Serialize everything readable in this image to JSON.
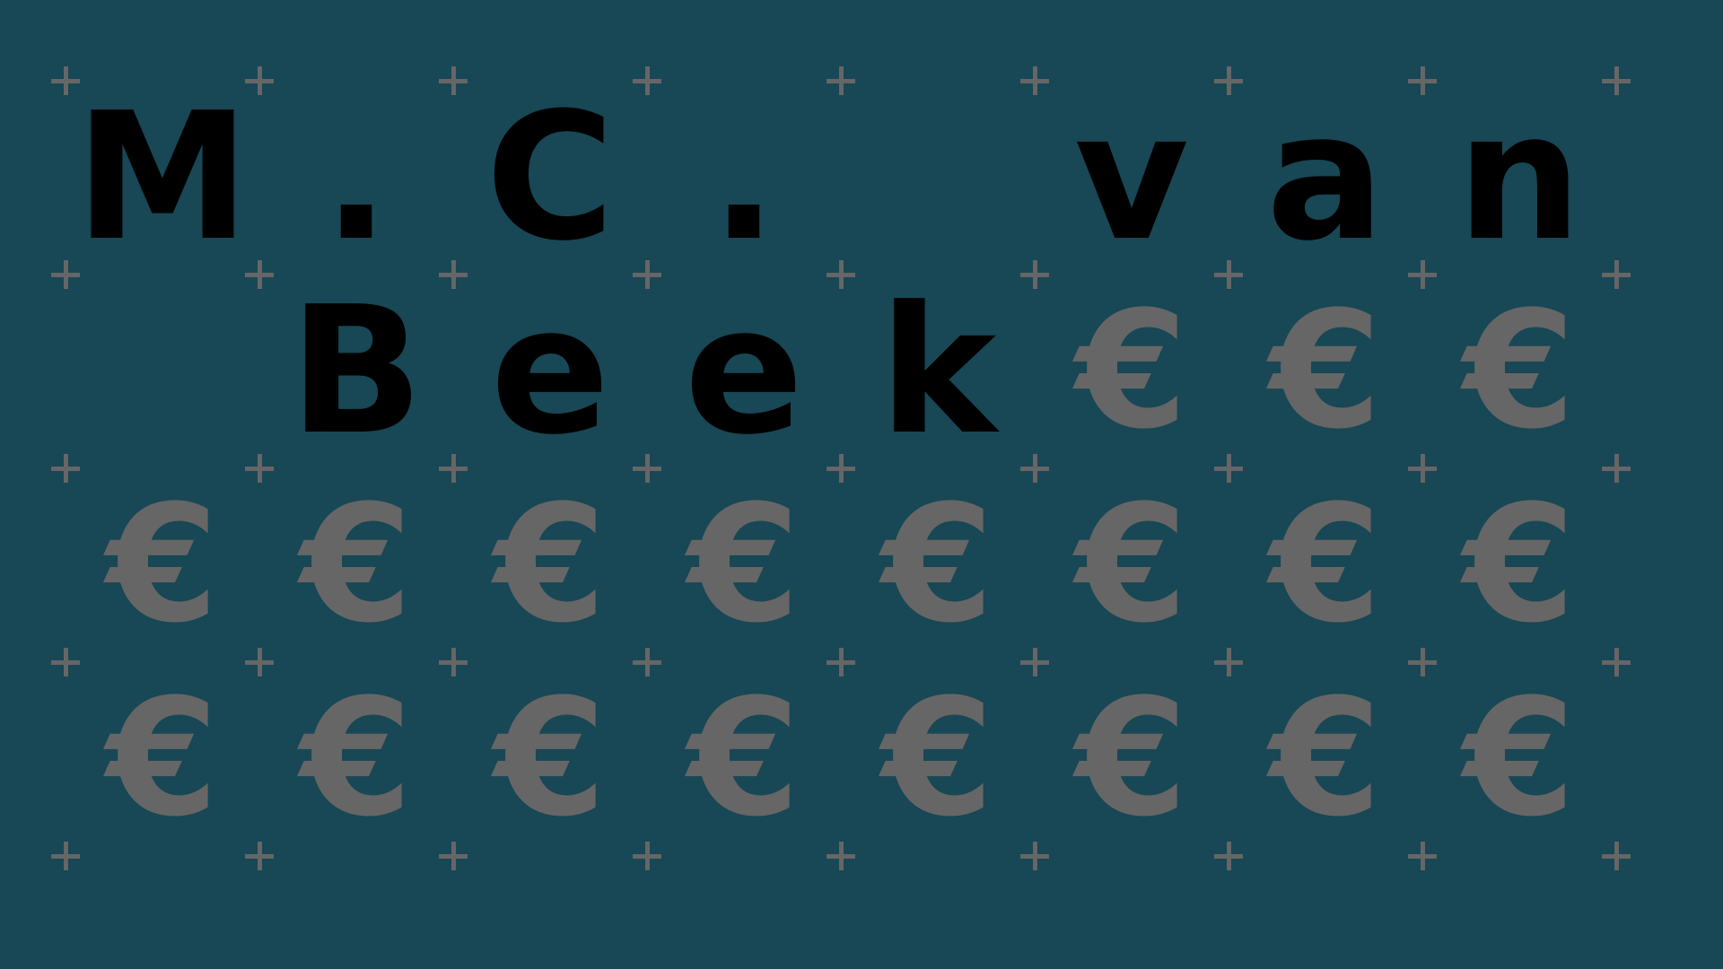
{
  "colors": {
    "background": "#184755",
    "text": "#000000",
    "symbol": "#666666"
  },
  "title": "M.C. van Beek",
  "cells": [
    [
      "M",
      ".",
      "C",
      ".",
      "",
      "v",
      "a",
      "n"
    ],
    [
      "",
      "B",
      "e",
      "e",
      "k",
      "€",
      "€",
      "€"
    ],
    [
      "€",
      "€",
      "€",
      "€",
      "€",
      "€",
      "€",
      "€"
    ],
    [
      "€",
      "€",
      "€",
      "€",
      "€",
      "€",
      "€",
      "€"
    ]
  ],
  "filler_symbol": "€",
  "marker_icon": "plus-icon"
}
